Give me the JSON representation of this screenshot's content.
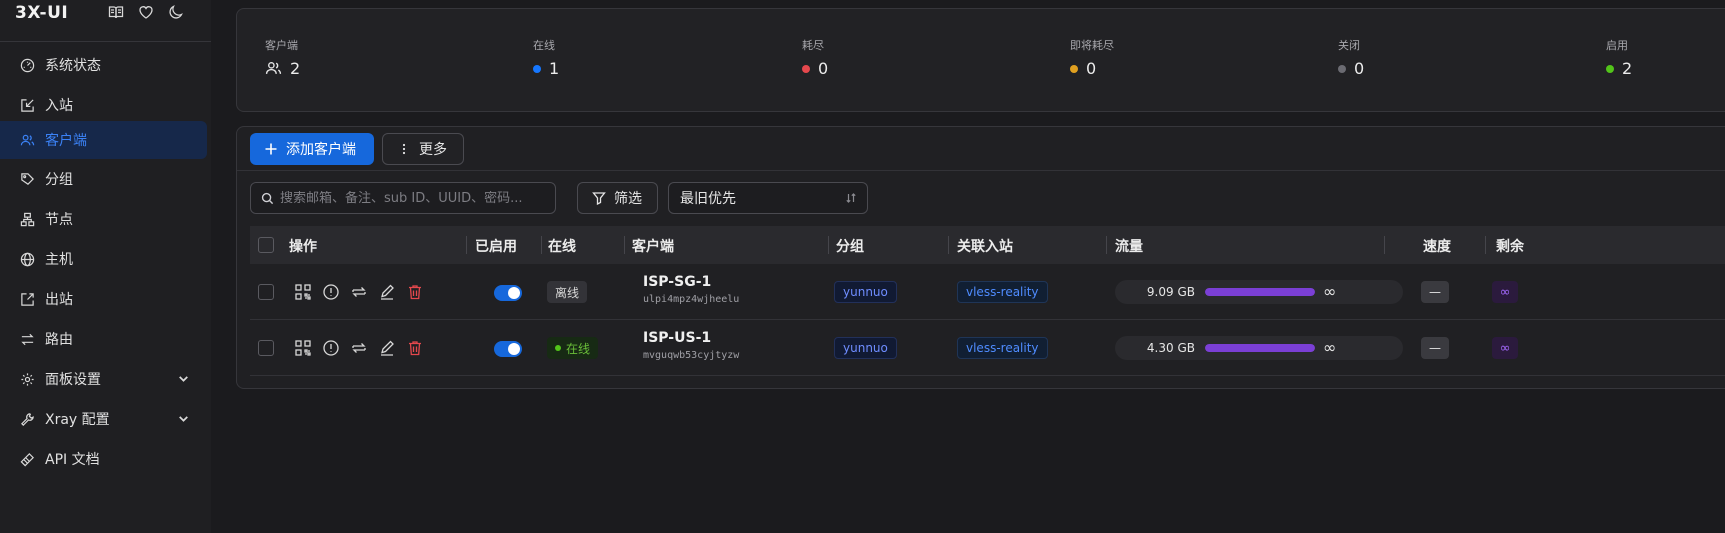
{
  "app": {
    "title": "3X-UI",
    "icons": [
      "book-icon",
      "heart-icon",
      "moon-icon"
    ]
  },
  "sidebar": {
    "items": [
      {
        "label": "系统状态",
        "icon": "dashboard-icon",
        "active": false
      },
      {
        "label": "入站",
        "icon": "inbound-icon",
        "active": false
      },
      {
        "label": "客户端",
        "icon": "users-icon",
        "active": true
      },
      {
        "label": "分组",
        "icon": "tag-icon",
        "active": false
      },
      {
        "label": "节点",
        "icon": "nodes-icon",
        "active": false
      },
      {
        "label": "主机",
        "icon": "globe-icon",
        "active": false
      },
      {
        "label": "出站",
        "icon": "outbound-icon",
        "active": false
      },
      {
        "label": "路由",
        "icon": "route-icon",
        "active": false
      },
      {
        "label": "面板设置",
        "icon": "gear-icon",
        "active": false,
        "expandable": true
      },
      {
        "label": "Xray 配置",
        "icon": "wrench-icon",
        "active": false,
        "expandable": true
      },
      {
        "label": "API 文档",
        "icon": "api-icon",
        "active": false
      }
    ]
  },
  "stats": [
    {
      "label": "客户端",
      "value": "2",
      "indicator": "users-icon"
    },
    {
      "label": "在线",
      "value": "1",
      "color": "#1677ff"
    },
    {
      "label": "耗尽",
      "value": "0",
      "color": "#e5484d"
    },
    {
      "label": "即将耗尽",
      "value": "0",
      "color": "#e0a020"
    },
    {
      "label": "关闭",
      "value": "0",
      "color": "#6b6b72"
    },
    {
      "label": "启用",
      "value": "2",
      "color": "#52c41a"
    }
  ],
  "toolbar": {
    "add_label": "添加客户端",
    "more_label": "更多",
    "search_placeholder": "搜索邮箱、备注、sub ID、UUID、密码...",
    "filter_label": "筛选",
    "sort_value": "最旧优先"
  },
  "table": {
    "headers": {
      "actions": "操作",
      "enabled": "已启用",
      "online": "在线",
      "client": "客户端",
      "group": "分组",
      "inbound": "关联入站",
      "traffic": "流量",
      "speed": "速度",
      "remaining": "剩余"
    },
    "rows": [
      {
        "name": "ISP-SG-1",
        "sub": "ulpi4mpz4wjheelu",
        "enabled": true,
        "status": "离线",
        "online": false,
        "group": "yunnuo",
        "inbound": "vless-reality",
        "traffic": "9.09 GB",
        "traffic_limit": "∞",
        "speed": "—",
        "remaining": "∞"
      },
      {
        "name": "ISP-US-1",
        "sub": "mvguqwb53cyjtyzw",
        "enabled": true,
        "status": "在线",
        "online": true,
        "group": "yunnuo",
        "inbound": "vless-reality",
        "traffic": "4.30 GB",
        "traffic_limit": "∞",
        "speed": "—",
        "remaining": "∞"
      }
    ]
  }
}
